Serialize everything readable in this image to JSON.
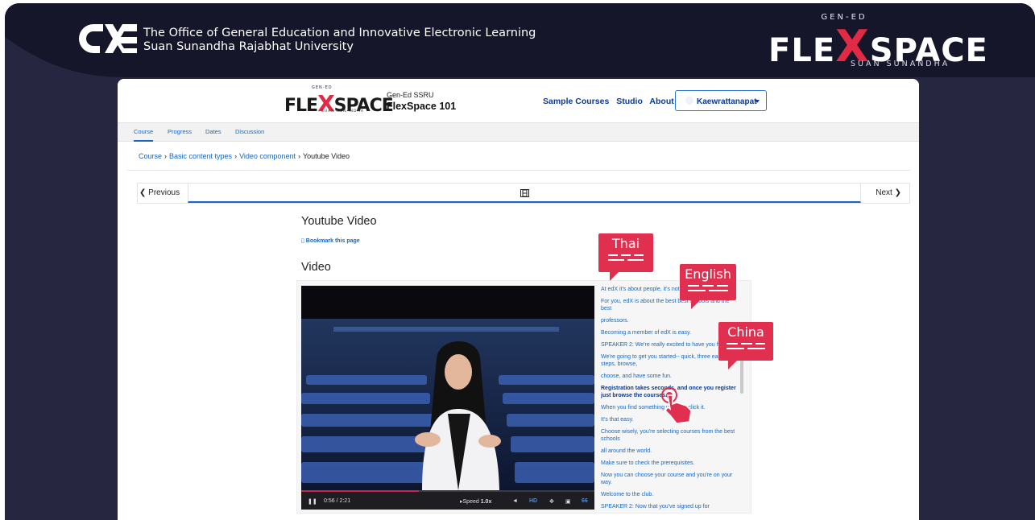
{
  "header": {
    "institution_line1": "The Office of General Education and Innovative Electronic Learning",
    "institution_line2": "Suan Sunandha Rajabhat University",
    "brand_top": "GEN-ED",
    "brand_left": "FLE",
    "brand_x": "X",
    "brand_right": "SPACE",
    "brand_sub": "SUAN SUNANDHA"
  },
  "site": {
    "logo_left": "FLE",
    "logo_x": "X",
    "logo_right": "SPACE",
    "logo_top": "GEN-ED",
    "logo_sub": "SUAN SUNANDHA",
    "course_org": "Gen-Ed SSRU",
    "course_name": "FlexSpace 101",
    "nav": [
      "Sample Courses",
      "Studio",
      "About"
    ],
    "user": "Kaewrattanapat"
  },
  "tabs": [
    "Course",
    "Progress",
    "Dates",
    "Discussion"
  ],
  "breadcrumb": [
    "Course",
    "Basic content types",
    "Video component",
    "Youtube Video"
  ],
  "sequence": {
    "previous": "Previous",
    "next": "Next"
  },
  "unit": {
    "title": "Youtube Video",
    "bookmark": "Bookmark this page",
    "video_heading": "Video"
  },
  "player": {
    "time": "0:56 / 2:21",
    "speed_label": "Speed",
    "speed_value": "1.0x",
    "hd": "HD",
    "cc": "66",
    "progress_fraction": 0.4
  },
  "transcript": [
    "At edX it's about people, it's not just",
    "For you, edX is about the best best schools and the best",
    "professors.",
    "Becoming a member of edX is easy.",
    "SPEAKER 2: We're really excited to have you here.",
    "We're going to get you started-- quick, three easy steps, browse,",
    "choose, and have some fun.",
    "Registration takes seconds, and once you register just browse the courses.",
    "When you find something you like, click it.",
    "It's that easy.",
    "Choose wisely, you're selecting courses from the best schools",
    "all around the world.",
    "Make sure to check the prerequisites.",
    "Now you can choose your course and you're on your way.",
    "Welcome to the club.",
    "SPEAKER 2: Now that you've signed up for"
  ],
  "transcript_active_index": 7,
  "language_bubbles": [
    "Thai",
    "English",
    "China"
  ],
  "colors": {
    "accent": "#e1304f",
    "link": "#1867c0",
    "frame": "#262640"
  }
}
